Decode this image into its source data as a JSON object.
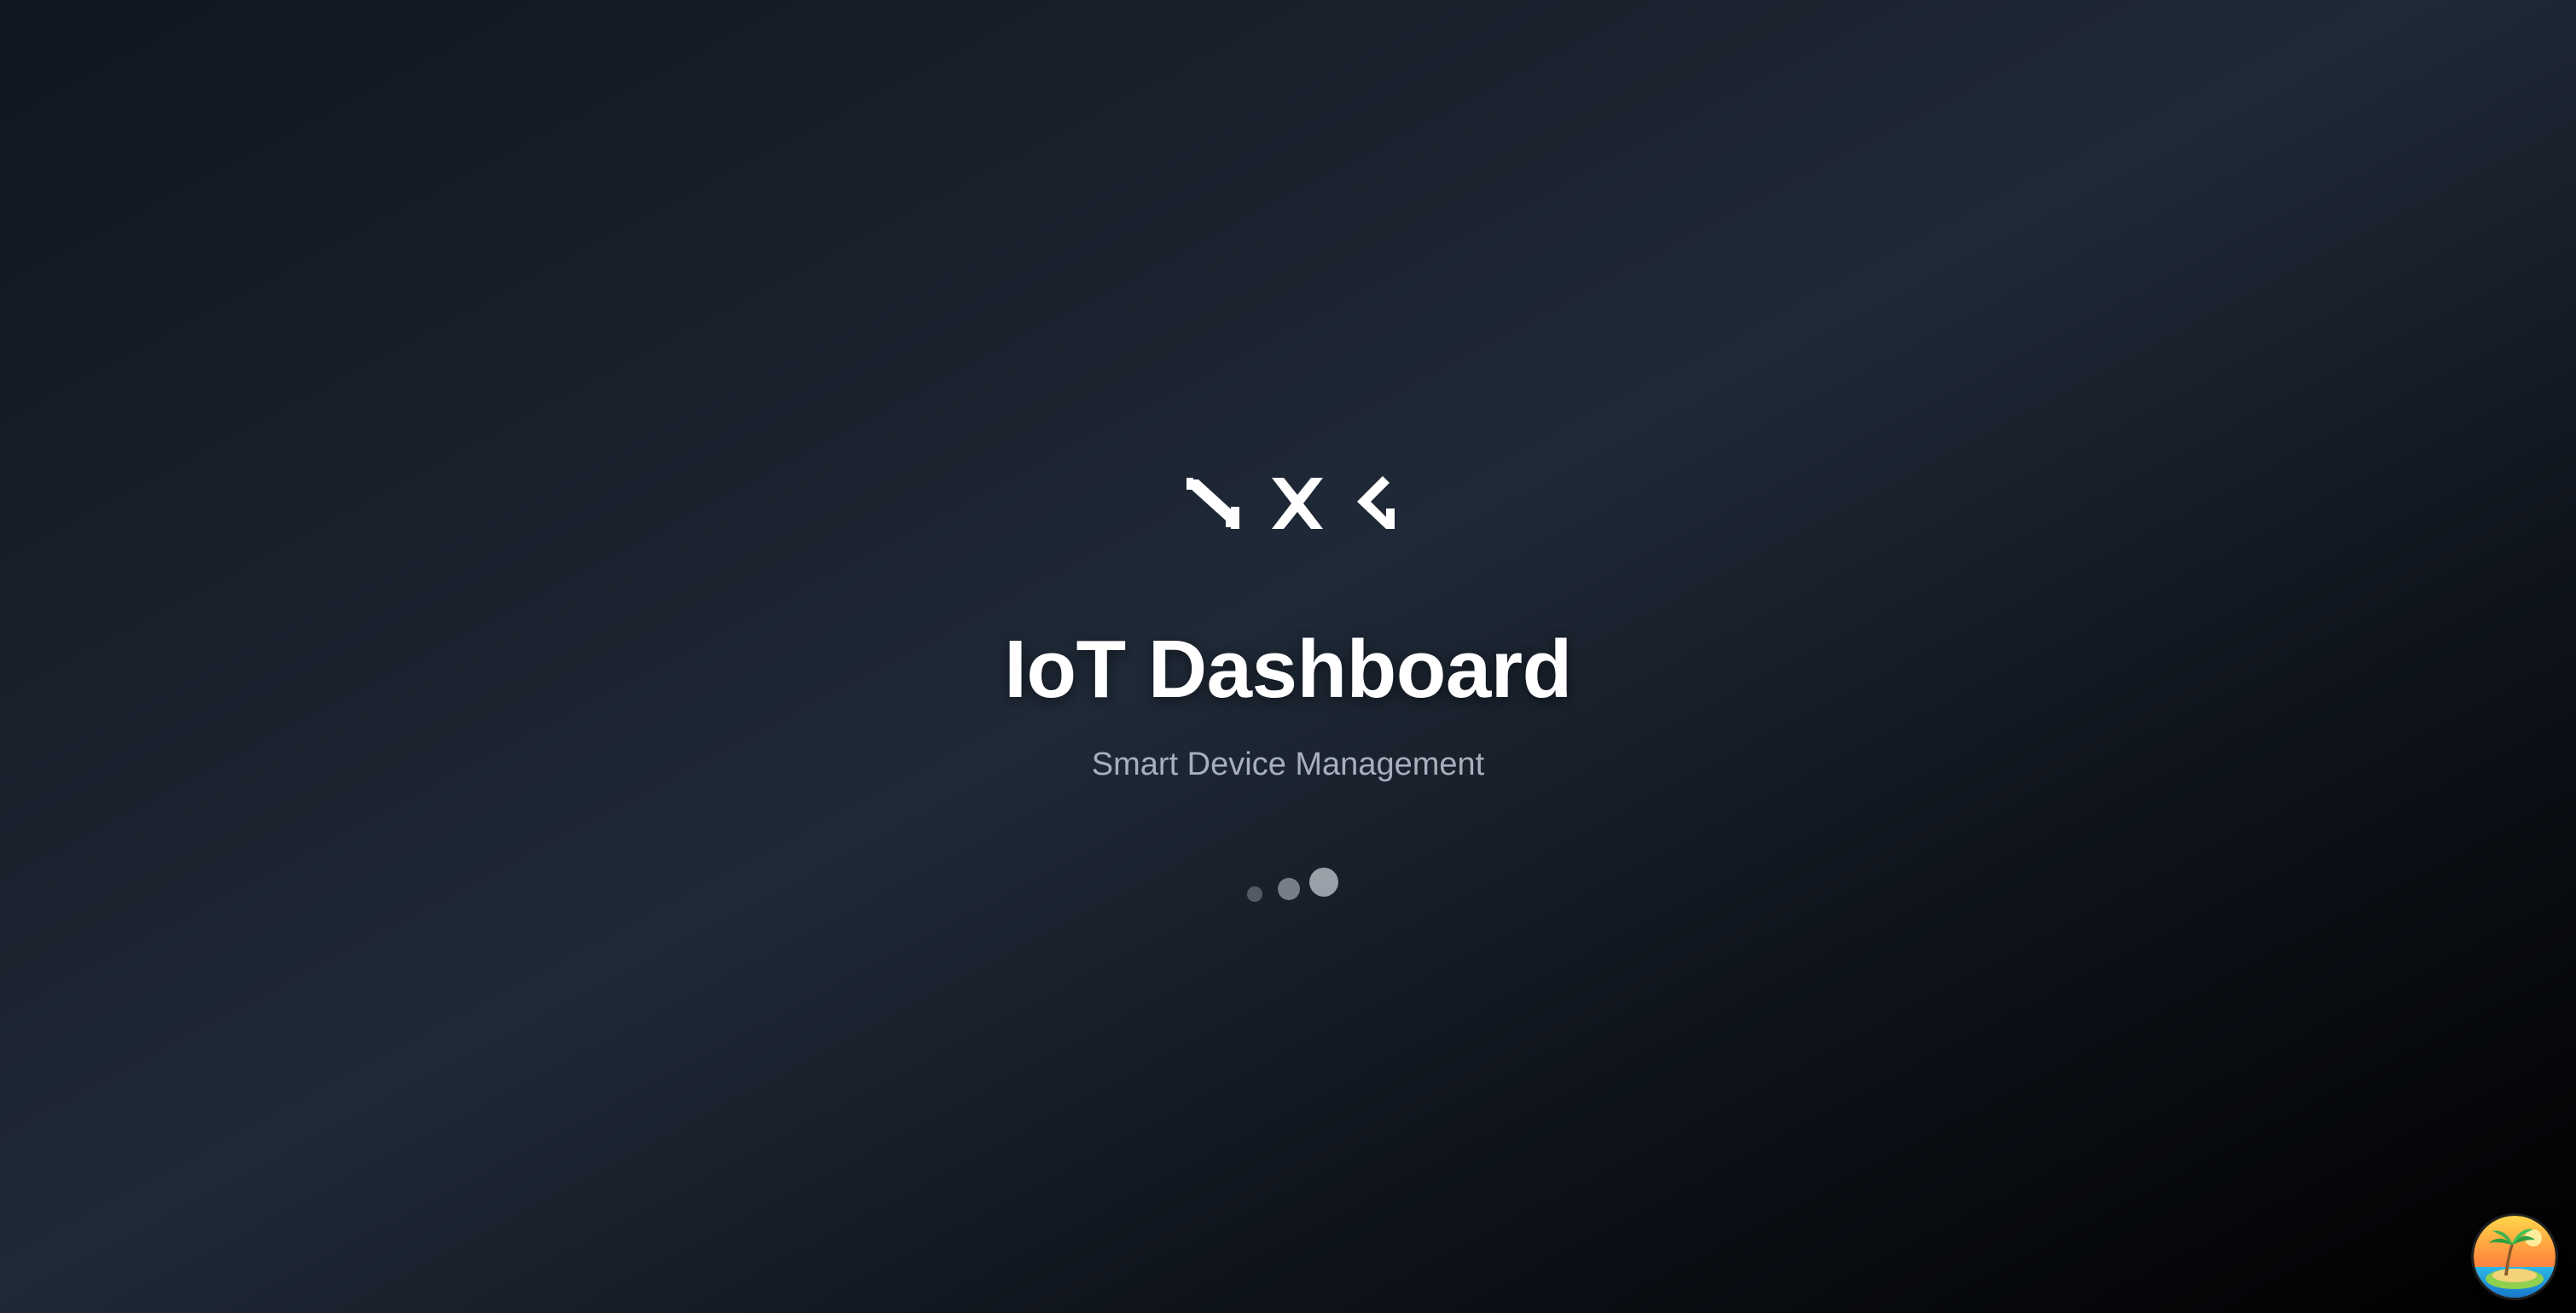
{
  "splash": {
    "logo_icon": "nxg-logo-icon",
    "title": "IoT Dashboard",
    "subtitle": "Smart Device Management",
    "loader_icon": "loading-dots-icon"
  },
  "corner_badge": {
    "icon": "tropical-island-avatar-icon"
  },
  "colors": {
    "background_top": "#1a202c",
    "background_mid": "#1f2937",
    "background_bottom": "#000000",
    "title": "#ffffff",
    "subtitle": "#a7afbd"
  }
}
